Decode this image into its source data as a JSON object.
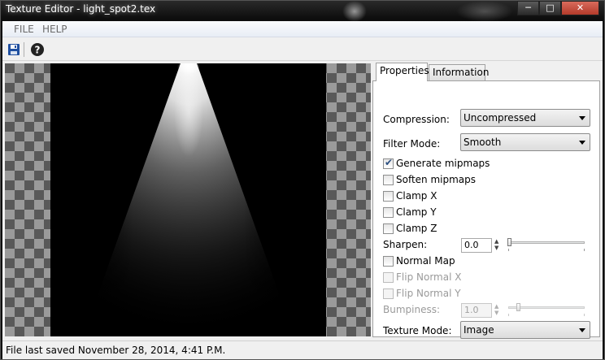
{
  "window": {
    "title": "Texture Editor - light_spot2.tex"
  },
  "menu": {
    "items": [
      "FILE",
      "HELP"
    ]
  },
  "toolbar": {
    "save_icon": "save-icon",
    "help_icon": "help-icon"
  },
  "tabs": [
    "Properties",
    "Information"
  ],
  "properties": {
    "compression_label": "Compression:",
    "compression_value": "Uncompressed",
    "filter_mode_label": "Filter Mode:",
    "filter_mode_value": "Smooth",
    "checkboxes": [
      {
        "label": "Generate mipmaps",
        "checked": true,
        "enabled": true
      },
      {
        "label": "Soften mipmaps",
        "checked": false,
        "enabled": true
      },
      {
        "label": "Clamp X",
        "checked": false,
        "enabled": true
      },
      {
        "label": "Clamp Y",
        "checked": false,
        "enabled": true
      },
      {
        "label": "Clamp Z",
        "checked": false,
        "enabled": true
      }
    ],
    "sharpen_label": "Sharpen:",
    "sharpen_value": "0.0",
    "normal_checkboxes": [
      {
        "label": "Normal Map",
        "checked": false,
        "enabled": true
      },
      {
        "label": "Flip Normal X",
        "checked": false,
        "enabled": false
      },
      {
        "label": "Flip Normal Y",
        "checked": false,
        "enabled": false
      }
    ],
    "bumpiness_label": "Bumpiness:",
    "bumpiness_value": "1.0",
    "texture_mode_label": "Texture Mode:",
    "texture_mode_value": "Image"
  },
  "status": {
    "text": "File last saved November 28, 2014, 4:41 P.M."
  },
  "colors": {
    "save_icon": "#1f4fa0",
    "checkbox_tick": "#2b4f81"
  }
}
